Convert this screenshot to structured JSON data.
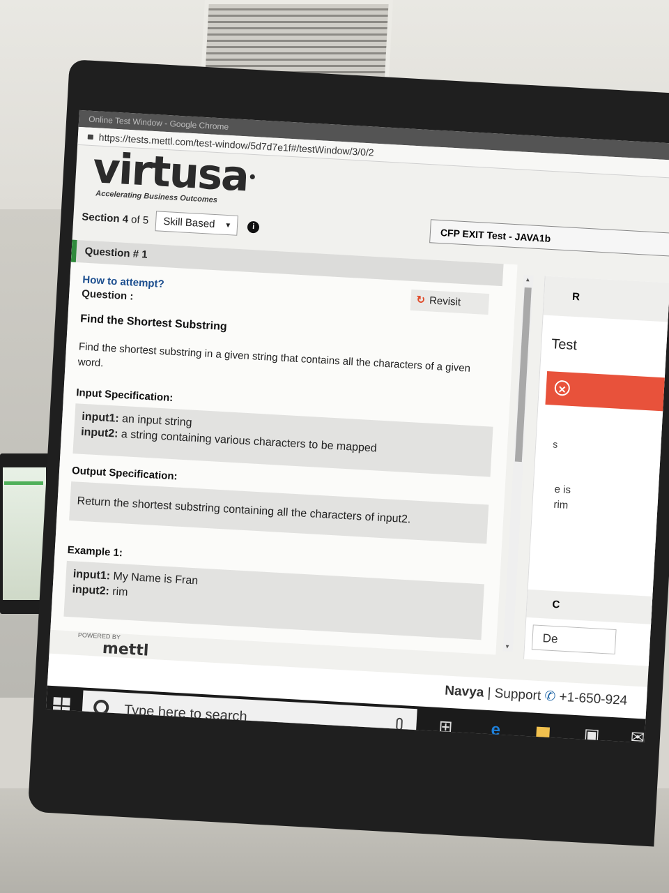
{
  "browser": {
    "window_title": "Online Test Window - Google Chrome",
    "url": "https://tests.mettl.com/test-window/5d7d7e1f#/testWindow/3/0/2"
  },
  "brand": {
    "logo": "virtusa",
    "tagline": "Accelerating Business Outcomes"
  },
  "section": {
    "label": "Section",
    "current": "4",
    "of_text": "of 5",
    "selected": "Skill Based"
  },
  "test_name": "CFP EXIT Test - JAVA1b",
  "question": {
    "header": "Question # 1",
    "how_to": "How to attempt?",
    "question_label": "Question :",
    "revisit_label": "Revisit",
    "title": "Find the Shortest Substring",
    "description": "Find the shortest substring in a given string that contains all the characters of a given word.",
    "input_spec_label": "Input Specification:",
    "input1_key": "input1:",
    "input1_text": "an input string",
    "input2_key": "input2:",
    "input2_text": "a string containing various characters to be mapped",
    "output_spec_label": "Output  Specification:",
    "output_text": "Return the shortest substring containing all the characters of input2.",
    "example_label": "Example 1:",
    "ex_input1_key": "input1:",
    "ex_input1_val": "My Name is Fran",
    "ex_input2_key": "input2:",
    "ex_input2_val": "rim"
  },
  "powered_by": "POWERED BY",
  "powered_brand": "mettl",
  "right_panel": {
    "head": "R",
    "test": "Test",
    "snippet_s": "s",
    "snippet_is": "e is",
    "snippet_rim": "rim",
    "c_head": "C",
    "de_field": "De"
  },
  "footer": {
    "user": "Navya",
    "separator": "|",
    "support": "Support",
    "phone": "+1-650-924"
  },
  "taskbar": {
    "search_placeholder": "Type here to search"
  }
}
